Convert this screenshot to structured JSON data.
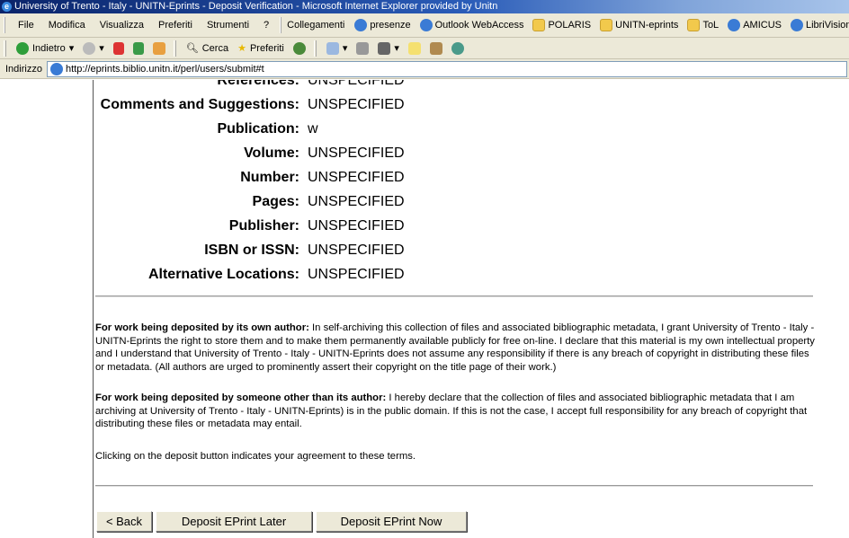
{
  "window": {
    "title": "University of Trento - Italy - UNITN-Eprints - Deposit Verification - Microsoft Internet Explorer provided by Unitn"
  },
  "menu": [
    "File",
    "Modifica",
    "Visualizza",
    "Preferiti",
    "Strumenti",
    "?"
  ],
  "links": {
    "label": "Collegamenti",
    "items": [
      {
        "label": "presenze",
        "icon": "ie-page-icon"
      },
      {
        "label": "Outlook WebAccess",
        "icon": "ie-page-icon"
      },
      {
        "label": "POLARIS",
        "icon": "folder-icon"
      },
      {
        "label": "UNITN-eprints",
        "icon": "folder-icon"
      },
      {
        "label": "ToL",
        "icon": "folder-icon"
      },
      {
        "label": "AMICUS",
        "icon": "ie-page-icon"
      },
      {
        "label": "LibriVision",
        "icon": "ie-page-icon"
      }
    ]
  },
  "toolbar": {
    "back": "Indietro",
    "search": "Cerca",
    "favorites": "Preferiti"
  },
  "address": {
    "label": "Indirizzo",
    "url": "http://eprints.biblio.unitn.it/perl/users/submit#t"
  },
  "fields": [
    {
      "label": "References:",
      "value": "UNSPECIFIED"
    },
    {
      "label": "Comments and Suggestions:",
      "value": "UNSPECIFIED"
    },
    {
      "label": "Publication:",
      "value": "w"
    },
    {
      "label": "Volume:",
      "value": "UNSPECIFIED"
    },
    {
      "label": "Number:",
      "value": "UNSPECIFIED"
    },
    {
      "label": "Pages:",
      "value": "UNSPECIFIED"
    },
    {
      "label": "Publisher:",
      "value": "UNSPECIFIED"
    },
    {
      "label": "ISBN or ISSN:",
      "value": "UNSPECIFIED"
    },
    {
      "label": "Alternative Locations:",
      "value": "UNSPECIFIED"
    }
  ],
  "terms": {
    "own_head": "For work being deposited by its own author:",
    "own_body": " In self-archiving this collection of files and associated bibliographic metadata, I grant University of Trento - Italy - UNITN-Eprints the right to store them and to make them permanently available publicly for free on-line. I declare that this material is my own intellectual property and I understand that University of Trento - Italy - UNITN-Eprints does not assume any responsibility if there is any breach of copyright in distributing these files or metadata. (All authors are urged to prominently assert their copyright on the title page of their work.)",
    "other_head": "For work being deposited by someone other than its author:",
    "other_body": " I hereby declare that the collection of files and associated bibliographic metadata that I am archiving at University of Trento - Italy - UNITN-Eprints) is in the public domain. If this is not the case, I accept full responsibility for any breach of copyright that distributing these files or metadata may entail.",
    "agree": "Clicking on the deposit button indicates your agreement to these terms."
  },
  "buttons": {
    "back": "< Back",
    "later": "Deposit EPrint Later",
    "now": "Deposit EPrint Now"
  }
}
